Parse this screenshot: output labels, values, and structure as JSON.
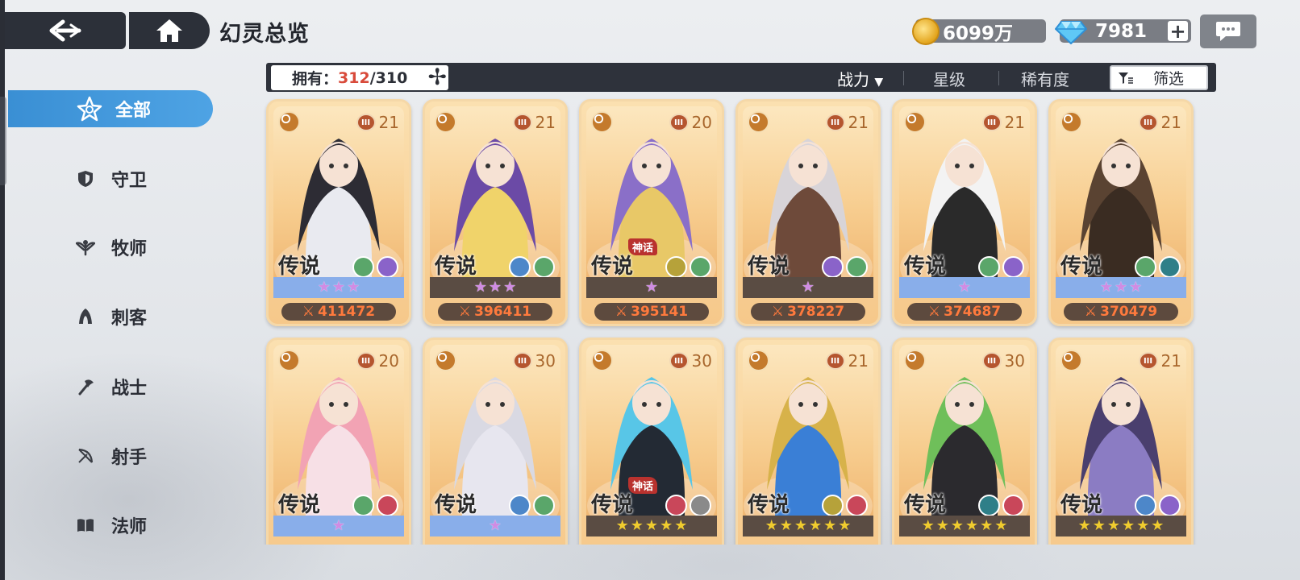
{
  "header": {
    "title": "幻灵总览",
    "gold": "6099万",
    "gems": "7981",
    "plus": "+"
  },
  "sidebar": {
    "items": [
      {
        "label": "全部",
        "icon": "star-outline-icon",
        "active": true
      },
      {
        "label": "守卫",
        "icon": "shield-icon",
        "active": false
      },
      {
        "label": "牧师",
        "icon": "wing-emblem-icon",
        "active": false
      },
      {
        "label": "刺客",
        "icon": "hood-icon",
        "active": false
      },
      {
        "label": "战士",
        "icon": "axe-icon",
        "active": false
      },
      {
        "label": "射手",
        "icon": "bow-icon",
        "active": false
      },
      {
        "label": "法师",
        "icon": "book-icon",
        "active": false
      }
    ]
  },
  "filter_bar": {
    "owned_label": "拥有：",
    "owned_count": "312",
    "owned_total": "/310",
    "sort_options": [
      "战力",
      "星级",
      "稀有度"
    ],
    "sort_arrow": "▼",
    "filter_label": "筛选"
  },
  "cards": [
    {
      "level": "21",
      "rarity": "传说",
      "mythic": "",
      "stars": 3,
      "star_bar": "blue",
      "power": "411472",
      "class_icon": "bow-icon",
      "elements": [
        "nature-icon",
        "arcane-icon"
      ]
    },
    {
      "level": "21",
      "rarity": "传说",
      "mythic": "",
      "stars": 3,
      "star_bar": "dark",
      "power": "396411",
      "class_icon": "axe-icon",
      "elements": [
        "frost-icon",
        "nature-icon"
      ]
    },
    {
      "level": "20",
      "rarity": "传说",
      "mythic": "神话",
      "stars": 1,
      "star_bar": "dark",
      "power": "395141",
      "class_icon": "shield-icon",
      "elements": [
        "wing-emblem-icon",
        "nature-icon"
      ]
    },
    {
      "level": "21",
      "rarity": "传说",
      "mythic": "",
      "stars": 1,
      "star_bar": "dark",
      "power": "378227",
      "class_icon": "hood-icon",
      "elements": [
        "arcane-icon",
        "nature-icon"
      ]
    },
    {
      "level": "21",
      "rarity": "传说",
      "mythic": "",
      "stars": 1,
      "star_bar": "blue",
      "power": "374687",
      "class_icon": "hood-icon",
      "elements": [
        "nature-icon",
        "arcane-icon"
      ]
    },
    {
      "level": "21",
      "rarity": "传说",
      "mythic": "",
      "stars": 3,
      "star_bar": "blue",
      "power": "370479",
      "class_icon": "axe-icon",
      "elements": [
        "nature-icon",
        "void-icon"
      ]
    },
    {
      "level": "20",
      "rarity": "传说",
      "mythic": "",
      "stars": 1,
      "star_bar": "blue",
      "power": "",
      "class_icon": "wing-emblem-icon",
      "elements": [
        "nature-icon",
        "spiral-icon"
      ]
    },
    {
      "level": "30",
      "rarity": "传说",
      "mythic": "",
      "stars": 1,
      "star_bar": "blue",
      "power": "",
      "class_icon": "book-icon",
      "elements": [
        "frost-icon",
        "nature-icon"
      ]
    },
    {
      "level": "30",
      "rarity": "传说",
      "mythic": "神话",
      "stars": 5,
      "star_bar": "dark",
      "power": "",
      "class_icon": "book-icon",
      "elements": [
        "spiral-icon",
        "light-icon"
      ]
    },
    {
      "level": "21",
      "rarity": "传说",
      "mythic": "",
      "stars": 6,
      "star_bar": "dark",
      "power": "",
      "class_icon": "hood-icon",
      "elements": [
        "wing-emblem-icon",
        "spiral-icon"
      ]
    },
    {
      "level": "30",
      "rarity": "传说",
      "mythic": "",
      "stars": 6,
      "star_bar": "dark",
      "power": "",
      "class_icon": "book-icon",
      "elements": [
        "void-icon",
        "spiral-icon"
      ]
    },
    {
      "level": "21",
      "rarity": "传说",
      "mythic": "",
      "stars": 6,
      "star_bar": "dark",
      "power": "",
      "class_icon": "hood-icon",
      "elements": [
        "frost-icon",
        "arcane-icon"
      ]
    }
  ],
  "colors": {
    "accent_blue": "#4ea3e4",
    "dark_panel": "#2e323b",
    "power_text": "#ff7a3d",
    "owned_highlight": "#d84a3a"
  }
}
